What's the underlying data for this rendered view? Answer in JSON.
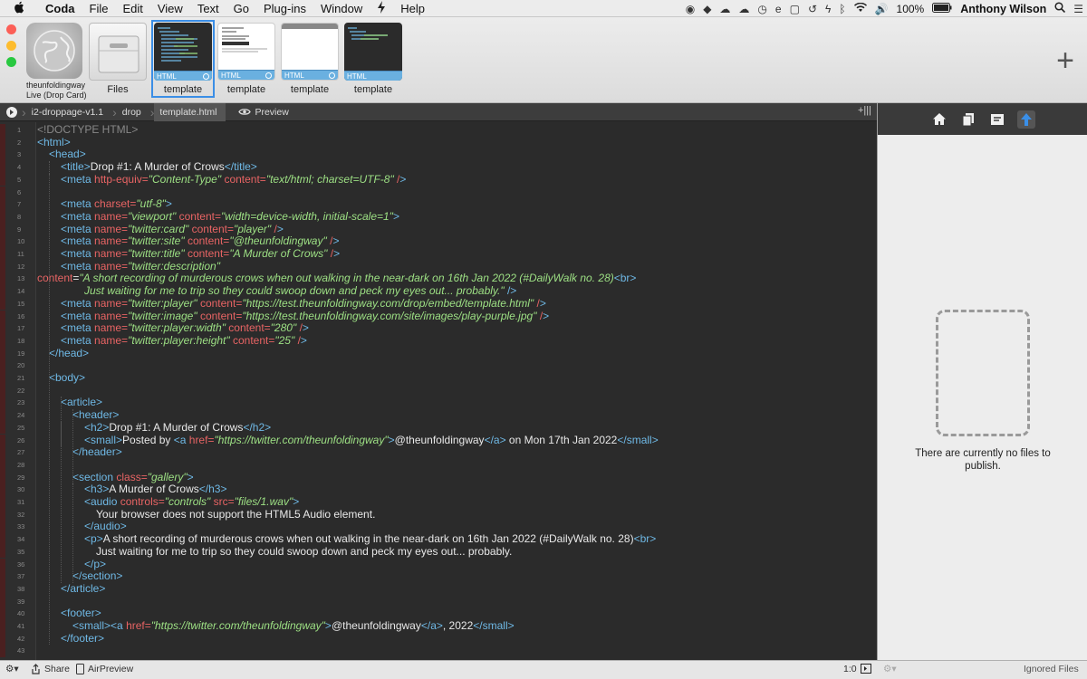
{
  "menubar": {
    "apple": "",
    "app": "Coda",
    "menus": [
      "File",
      "Edit",
      "View",
      "Text",
      "Go",
      "Plug-ins",
      "Window",
      "Help"
    ],
    "battery": "100%",
    "user": "Anthony Wilson"
  },
  "tiles": [
    {
      "cap": "theunfoldingway",
      "cap2": "Live (Drop Card)"
    },
    {
      "cap": "Files"
    },
    {
      "cap": "template",
      "badge": "HTML"
    },
    {
      "cap": "template",
      "badge": "HTML"
    },
    {
      "cap": "template",
      "badge": "HTML"
    },
    {
      "cap": "template",
      "badge": "HTML"
    }
  ],
  "pathbar": {
    "crumbs": [
      "i2-droppage-v1.1",
      "drop",
      "template.html"
    ],
    "preview": "Preview"
  },
  "code": [
    "<!DOCTYPE HTML>",
    "<html>",
    "<head>",
    "<title>Drop #1: A Murder of Crows</title>",
    "<meta http-equiv=\"Content-Type\" content=\"text/html; charset=UTF-8\" />",
    "",
    "<meta charset=\"utf-8\">",
    "<meta name=\"viewport\" content=\"width=device-width, initial-scale=1\">",
    "<meta name=\"twitter:card\" content=\"player\" />",
    "<meta name=\"twitter:site\" content=\"@theunfoldingway\" />",
    "<meta name=\"twitter:title\" content=\"A Murder of Crows\" />",
    "<meta name=\"twitter:description\"",
    "content=\"A short recording of murderous crows when out walking in the near-dark on 16th Jan 2022 (#DailyWalk no. 28)<br>",
    "Just waiting for me to trip so they could swoop down and peck my eyes out... probably.\" />",
    "<meta name=\"twitter:player\" content=\"https://test.theunfoldingway.com/drop/embed/template.html\" />",
    "<meta name=\"twitter:image\" content=\"https://test.theunfoldingway.com/site/images/play-purple.jpg\" />",
    "<meta name=\"twitter:player:width\" content=\"280\" />",
    "<meta name=\"twitter:player:height\" content=\"25\" />",
    "</head>",
    "",
    "<body>",
    "",
    "<article>",
    "<header>",
    "<h2>Drop #1: A Murder of Crows</h2>",
    "<small>Posted by <a href=\"https://twitter.com/theunfoldingway\">@theunfoldingway</a> on Mon 17th Jan 2022</small>",
    "</header>",
    "",
    "<section class=\"gallery\">",
    "<h3>A Murder of Crows</h3>",
    "<audio controls=\"controls\" src=\"files/1.wav\">",
    "Your browser does not support the HTML5 Audio element.",
    "</audio>",
    "<p>A short recording of murderous crows when out walking in the near-dark on 16th Jan 2022 (#DailyWalk no. 28)<br>",
    "Just waiting for me to trip so they could swoop down and peck my eyes out... probably.",
    "</p>",
    "</section>",
    "</article>",
    "",
    "<footer>",
    "<small><a href=\"https://twitter.com/theunfoldingway\">@theunfoldingway</a>, 2022</small>",
    "</footer>",
    ""
  ],
  "sidebar": {
    "empty": "There are currently no files to publish.",
    "ignored": "Ignored Files"
  },
  "bottom": {
    "share": "Share",
    "airpreview": "AirPreview",
    "pos": "1:0"
  }
}
